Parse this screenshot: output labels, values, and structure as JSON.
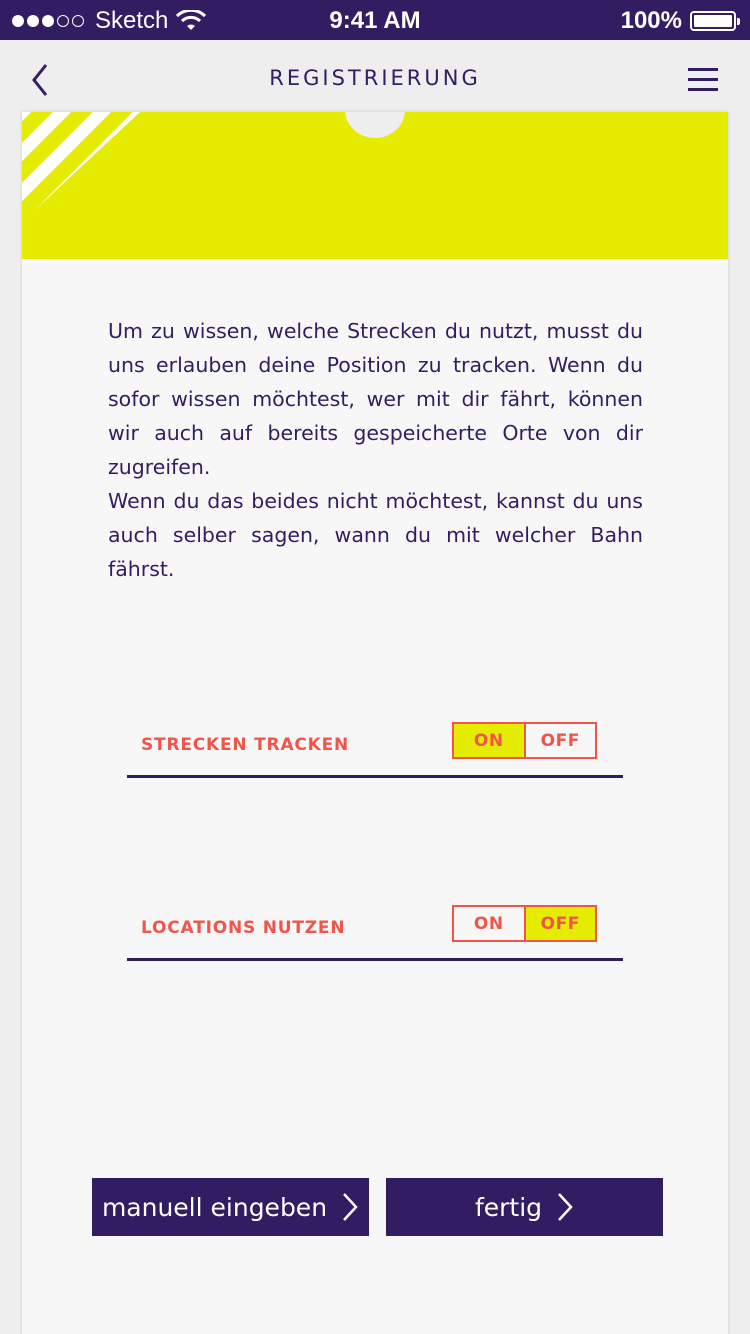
{
  "status_bar": {
    "carrier": "Sketch",
    "time": "9:41 AM",
    "battery": "100%"
  },
  "nav": {
    "title": "REGISTRIERUNG",
    "back_icon": "chevron-left-icon",
    "menu_icon": "hamburger-menu-icon"
  },
  "content": {
    "paragraph_1": "Um zu wissen, welche Strecken du nutzt, musst du uns erlauben deine Position zu tracken. Wenn du sofor wissen möchtest, wer mit dir fährt, können wir auch auf bereits gespeicherte Orte von dir zugreifen.",
    "paragraph_2": "Wenn du das beides nicht möchtest, kannst du uns auch selber sagen, wann du mit welcher Bahn  fährst."
  },
  "toggles": [
    {
      "label": "STRECKEN TRACKEN",
      "on_label": "ON",
      "off_label": "OFF",
      "value": "ON"
    },
    {
      "label": "LOCATIONS NUTZEN",
      "on_label": "ON",
      "off_label": "OFF",
      "value": "OFF"
    }
  ],
  "buttons": {
    "manual_label": "manuell eingeben",
    "done_label": "fertig"
  },
  "colors": {
    "primary": "#321c62",
    "accent_yellow": "#e6ec00",
    "accent_red": "#f0554b",
    "background": "#eeeeee",
    "card": "#f7f7f7"
  }
}
